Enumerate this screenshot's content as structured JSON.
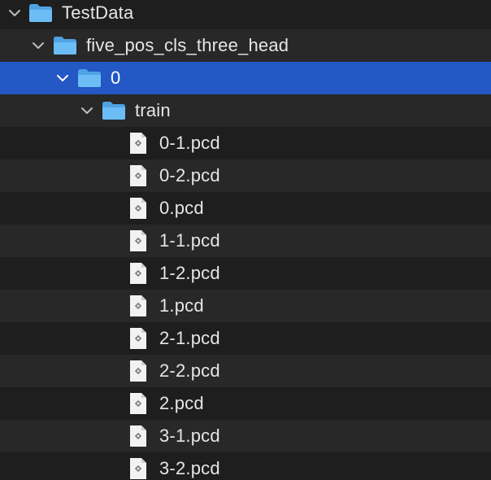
{
  "tree": {
    "nodes": [
      {
        "label": "TestData",
        "kind": "folder",
        "expanded": true,
        "selected": false
      },
      {
        "label": "five_pos_cls_three_head",
        "kind": "folder",
        "expanded": true,
        "selected": false
      },
      {
        "label": "0",
        "kind": "folder",
        "expanded": true,
        "selected": true
      },
      {
        "label": "train",
        "kind": "folder",
        "expanded": true,
        "selected": false
      },
      {
        "label": "0-1.pcd",
        "kind": "file",
        "selected": false
      },
      {
        "label": "0-2.pcd",
        "kind": "file",
        "selected": false
      },
      {
        "label": "0.pcd",
        "kind": "file",
        "selected": false
      },
      {
        "label": "1-1.pcd",
        "kind": "file",
        "selected": false
      },
      {
        "label": "1-2.pcd",
        "kind": "file",
        "selected": false
      },
      {
        "label": "1.pcd",
        "kind": "file",
        "selected": false
      },
      {
        "label": "2-1.pcd",
        "kind": "file",
        "selected": false
      },
      {
        "label": "2-2.pcd",
        "kind": "file",
        "selected": false
      },
      {
        "label": "2.pcd",
        "kind": "file",
        "selected": false
      },
      {
        "label": "3-1.pcd",
        "kind": "file",
        "selected": false
      },
      {
        "label": "3-2.pcd",
        "kind": "file",
        "selected": false
      }
    ]
  },
  "colors": {
    "background": "#1e1e1e",
    "row_alt": "#282828",
    "selection": "#2358c5",
    "folder": "#5fb4f2",
    "text": "#e6e6e6"
  },
  "icons": {
    "folder": "folder-icon",
    "file": "pcd-file-icon",
    "disclosure": "chevron-down-icon"
  }
}
